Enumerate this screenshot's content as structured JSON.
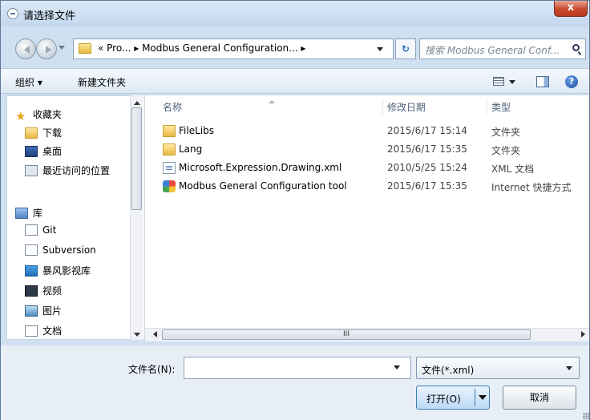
{
  "window": {
    "title": "请选择文件",
    "close_label": "x"
  },
  "address": {
    "path": "« Pro... ▸ Modbus General Configuration... ▸",
    "search_placeholder": "搜索 Modbus General Conf..."
  },
  "toolbar": {
    "organize": "组织 ▾",
    "new_folder": "新建文件夹"
  },
  "sidebar": {
    "favorites_header": "收藏夹",
    "favorites": [
      "下载",
      "桌面",
      "最近访问的位置"
    ],
    "libraries_header": "库",
    "libraries": [
      "Git",
      "Subversion",
      "暴风影视库",
      "视频",
      "图片",
      "文档"
    ]
  },
  "columns": {
    "name": "名称",
    "date": "修改日期",
    "type": "类型"
  },
  "files": [
    {
      "name": "FileLibs",
      "date": "2015/6/17 15:14",
      "type": "文件夹",
      "icon": "folder-icon"
    },
    {
      "name": "Lang",
      "date": "2015/6/17 15:35",
      "type": "文件夹",
      "icon": "folder-icon"
    },
    {
      "name": "Microsoft.Expression.Drawing.xml",
      "date": "2010/5/25 15:24",
      "type": "XML 文档",
      "icon": "xml-file-icon"
    },
    {
      "name": "Modbus General Configuration tool",
      "date": "2015/6/17 15:35",
      "type": "Internet 快捷方式",
      "icon": "shortcut-icon"
    }
  ],
  "bottom": {
    "filename_label": "文件名(N):",
    "filename_value": "",
    "filetype": "文件(*.xml)",
    "open": "打开(O)",
    "cancel": "取消"
  },
  "scrollbar_grip": "III"
}
